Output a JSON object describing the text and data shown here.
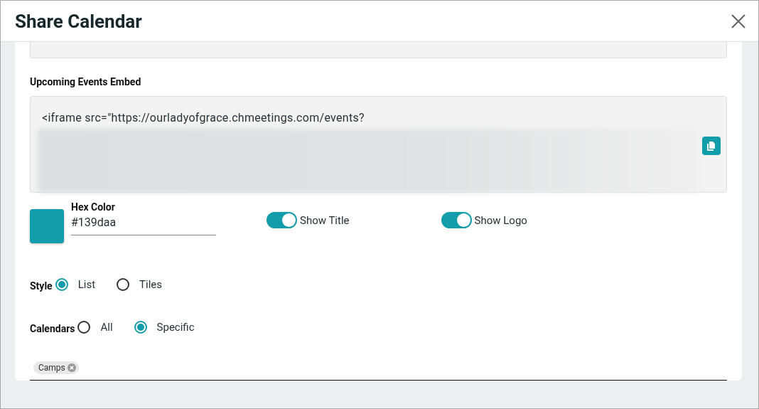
{
  "dialog": {
    "title": "Share Calendar"
  },
  "embed": {
    "label": "Upcoming Events Embed",
    "code_line": "<iframe src=\"https://ourladyofgrace.chmeetings.com/events?"
  },
  "hex_color": {
    "label": "Hex Color",
    "value": "#139daa"
  },
  "toggles": [
    {
      "label": "Show Title",
      "on": true
    },
    {
      "label": "Show Logo",
      "on": true
    }
  ],
  "style": {
    "label": "Style",
    "options": [
      {
        "label": "List",
        "selected": true
      },
      {
        "label": "Tiles",
        "selected": false
      }
    ]
  },
  "calendars": {
    "label": "Calendars",
    "options": [
      {
        "label": "All",
        "selected": false
      },
      {
        "label": "Specific",
        "selected": true
      }
    ],
    "chips": [
      "Camps"
    ]
  }
}
